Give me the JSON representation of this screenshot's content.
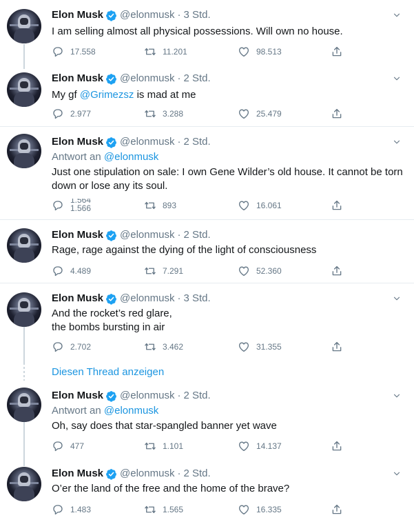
{
  "author": {
    "name": "Elon Musk",
    "handle": "@elonmusk",
    "separator": "·"
  },
  "show_thread_label": "Diesen Thread anzeigen",
  "tweets": [
    {
      "time": "3 Std.",
      "text": "I am selling almost all physical possessions. Will own no house.",
      "replies": "17.558",
      "retweets": "11.201",
      "likes": "98.513"
    },
    {
      "time": "2 Std.",
      "text_prefix": "My gf ",
      "mention": "@Grimezsz",
      "text_suffix": " is mad at me",
      "replies": "2.977",
      "retweets": "3.288",
      "likes": "25.479"
    },
    {
      "time": "2 Std.",
      "replying_prefix": "Antwort an ",
      "replying_handle": "@elonmusk",
      "text": "Just one stipulation on sale: I own Gene Wilder’s old house. It cannot be torn down or lose any its soul.",
      "replies_old": "1.564",
      "replies": "1.566",
      "retweets": "893",
      "likes": "16.061"
    },
    {
      "time": "2 Std.",
      "text": "Rage, rage against the dying of the light of consciousness",
      "replies": "4.489",
      "retweets": "7.291",
      "likes": "52.360"
    },
    {
      "time": "3 Std.",
      "text_line1": "And the rocket’s red glare,",
      "text_line2": "the bombs bursting in air",
      "replies": "2.702",
      "retweets": "3.462",
      "likes": "31.355"
    },
    {
      "time": "2 Std.",
      "replying_prefix": "Antwort an ",
      "replying_handle": "@elonmusk",
      "text": "Oh, say does that star-spangled banner yet wave",
      "replies": "477",
      "retweets": "1.101",
      "likes": "14.137"
    },
    {
      "time": "2 Std.",
      "text": "O’er the land of the free and the home of the brave?",
      "replies": "1.483",
      "retweets": "1.565",
      "likes": "16.335"
    }
  ],
  "colors": {
    "link": "#1b95e0",
    "muted": "#657786",
    "text": "#14171a",
    "border": "#e6ecf0",
    "verified": "#1da1f2"
  },
  "icons": {
    "reply": "reply-icon",
    "retweet": "retweet-icon",
    "like": "heart-icon",
    "share": "share-icon",
    "verified": "verified-badge-icon",
    "menu": "chevron-down-icon"
  }
}
